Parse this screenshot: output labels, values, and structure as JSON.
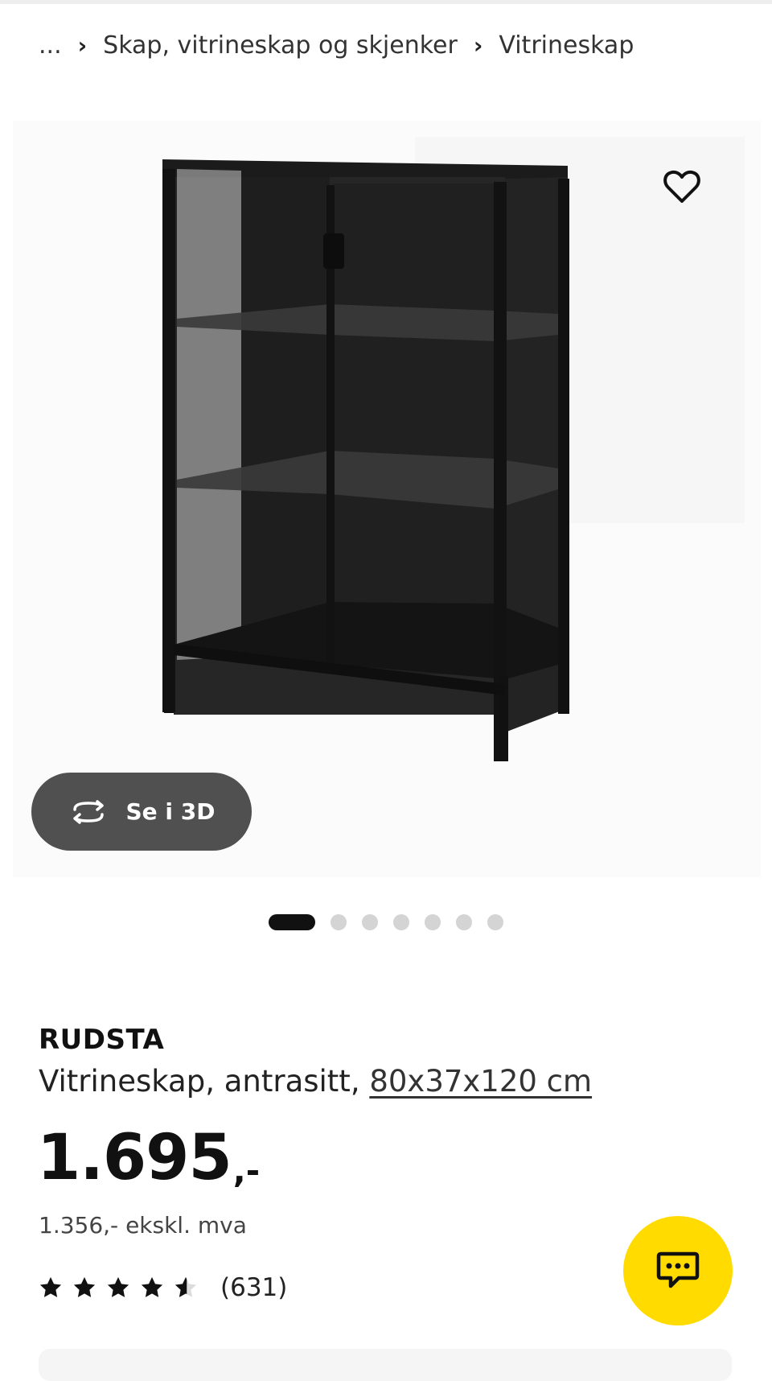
{
  "breadcrumb": {
    "ellipsis": "...",
    "items": [
      {
        "label": "Skap, vitrineskap og skjenker"
      },
      {
        "label": "Vitrineskap"
      }
    ],
    "separator": "›"
  },
  "gallery": {
    "favorite_icon": "heart-outline-icon",
    "view_3d": {
      "label": "Se i 3D",
      "icon": "rotate-3d-icon"
    },
    "dots_total": 7,
    "dots_active_index": 0
  },
  "product": {
    "name": "RUDSTA",
    "description": "Vitrineskap, antrasitt,",
    "dimensions": "80x37x120 cm",
    "price": {
      "amount": "1.695",
      "suffix": ",-",
      "ex_vat": "1.356,- ekskl. mva"
    },
    "rating": {
      "stars": 4.5,
      "max": 5,
      "count_label": "(631)"
    }
  },
  "chat": {
    "icon": "chat-bubble-icon"
  },
  "colors": {
    "accent_yellow": "#ffdb00",
    "dark_button": "#505050",
    "text": "#111111",
    "inactive_dot": "#d4d4d4"
  }
}
